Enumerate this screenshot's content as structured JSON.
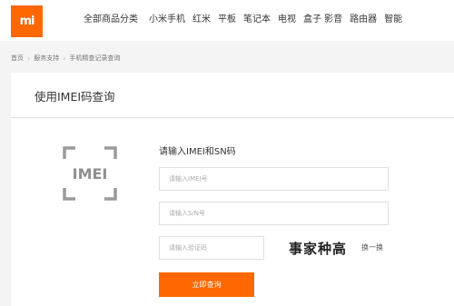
{
  "header": {
    "logo_text": "mi",
    "nav": [
      "全部商品分类",
      "小米手机",
      "红米",
      "平板",
      "笔记本",
      "电视",
      "盒子 影音",
      "路由器",
      "智能"
    ]
  },
  "breadcrumb": [
    "首页",
    "服务支持",
    "手机精查记录查询"
  ],
  "panel": {
    "title": "使用IMEI码查询",
    "icon_text": "IMEI",
    "form_heading": "请输入IMEI和SN码",
    "imei_placeholder": "请输入IMEI号",
    "sn_placeholder": "请输入S/N号",
    "captcha_placeholder": "请输入验证码",
    "captcha_text": "事家种高",
    "refresh_label": "换一换",
    "submit_label": "立即查询"
  },
  "colors": {
    "accent": "#ff6700",
    "page_background": "#f4f4f4"
  }
}
